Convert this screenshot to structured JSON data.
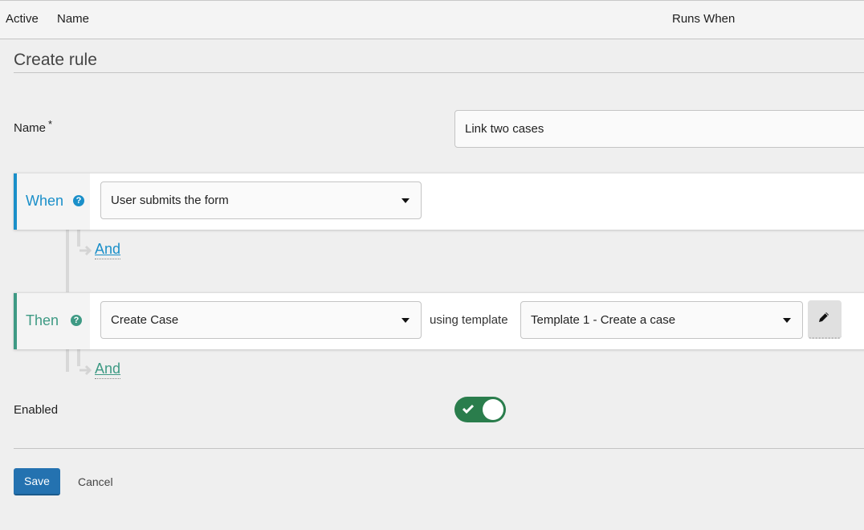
{
  "table_header": {
    "columns": [
      "Active",
      "Name",
      "Runs When"
    ]
  },
  "form": {
    "title": "Create rule",
    "name_label": "Name",
    "required_marker": "*",
    "name_value": "Link two cases",
    "when": {
      "keyword": "When",
      "help_icon": "question-circle-icon",
      "trigger_selected": "User submits the form",
      "and_link": "And",
      "color": "#1a8fc9"
    },
    "then": {
      "keyword": "Then",
      "help_icon": "question-circle-icon",
      "action_selected": "Create Case",
      "using_label": "using template",
      "template_selected": "Template 1 - Create a case",
      "edit_icon": "pencil-icon",
      "and_link": "And",
      "color": "#3e9a84"
    },
    "enabled_label": "Enabled",
    "enabled": true,
    "toggle_color": "#2a7d4c",
    "save_label": "Save",
    "cancel_label": "Cancel",
    "save_color": "#2472b0"
  }
}
